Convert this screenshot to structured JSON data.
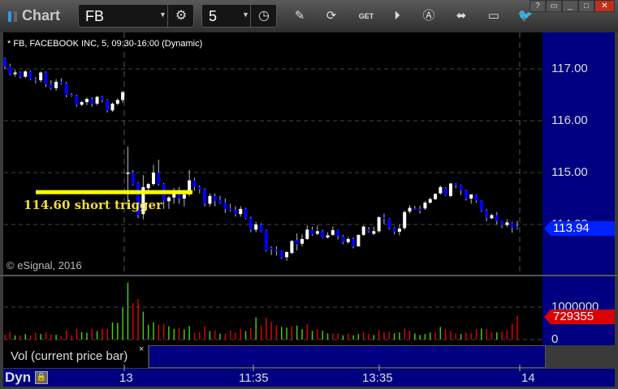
{
  "app": {
    "title": "Chart"
  },
  "toolbar": {
    "symbol": "FB",
    "interval": "5",
    "icons": [
      "settings-gear-icon",
      "clock-icon",
      "pencil-icon",
      "chart-refresh-icon",
      "get-icon",
      "play-icon",
      "alert-icon",
      "link-icon",
      "comment-icon",
      "twitter-icon"
    ],
    "get_label": "GET"
  },
  "window": {
    "help": "?",
    "minimize": "_",
    "maximize": "□",
    "close": "✕"
  },
  "chart": {
    "legend": "* FB, FACEBOOK INC, 5, 09:30-16:00 (Dynamic)",
    "copyright": "© eSignal, 2016",
    "annotation": {
      "label": "114.60 short trigger",
      "price": 114.6,
      "color": "#ffff00"
    },
    "price_ticks": [
      "117.00",
      "116.00",
      "115.00",
      "114.00"
    ],
    "price_tick_values": [
      117,
      116,
      115,
      114
    ],
    "last_price": "113.94",
    "colors": {
      "up": "#ffffff",
      "down": "#0000ff",
      "vol_up": "#44cc11",
      "vol_down": "#dd0000",
      "last_tag": "#0022ff",
      "vol_tag": "#dd0000"
    }
  },
  "chart_data": {
    "type": "candlestick",
    "session_break_index": 24,
    "ohlc": [
      [
        117.2,
        117.22,
        117.0,
        117.05
      ],
      [
        117.05,
        117.1,
        116.88,
        116.9
      ],
      [
        116.9,
        116.98,
        116.85,
        116.93
      ],
      [
        116.93,
        116.95,
        116.82,
        116.85
      ],
      [
        116.85,
        116.98,
        116.82,
        116.95
      ],
      [
        116.95,
        116.97,
        116.78,
        116.8
      ],
      [
        116.8,
        116.84,
        116.72,
        116.78
      ],
      [
        116.78,
        116.95,
        116.74,
        116.93
      ],
      [
        116.93,
        116.95,
        116.65,
        116.7
      ],
      [
        116.7,
        116.78,
        116.6,
        116.63
      ],
      [
        116.63,
        116.8,
        116.58,
        116.75
      ],
      [
        116.75,
        116.82,
        116.7,
        116.72
      ],
      [
        116.72,
        116.75,
        116.45,
        116.5
      ],
      [
        116.5,
        116.53,
        116.46,
        116.48
      ],
      [
        116.48,
        116.5,
        116.27,
        116.31
      ],
      [
        116.31,
        116.38,
        116.28,
        116.36
      ],
      [
        116.36,
        116.45,
        116.3,
        116.42
      ],
      [
        116.42,
        116.45,
        116.27,
        116.33
      ],
      [
        116.33,
        116.48,
        116.3,
        116.46
      ],
      [
        116.46,
        116.48,
        116.35,
        116.4
      ],
      [
        116.4,
        116.42,
        116.16,
        116.2
      ],
      [
        116.2,
        116.35,
        116.17,
        116.33
      ],
      [
        116.33,
        116.43,
        116.3,
        116.4
      ],
      [
        116.4,
        116.58,
        116.35,
        116.55
      ],
      [
        114.98,
        115.5,
        114.3,
        115.0
      ],
      [
        115.0,
        115.05,
        114.75,
        114.77
      ],
      [
        114.8,
        114.82,
        114.12,
        114.18
      ],
      [
        114.2,
        114.95,
        114.1,
        114.72
      ],
      [
        114.7,
        114.8,
        114.6,
        114.78
      ],
      [
        114.78,
        115.15,
        114.75,
        115.0
      ],
      [
        115.0,
        115.25,
        114.75,
        114.78
      ],
      [
        114.78,
        114.8,
        114.3,
        114.45
      ],
      [
        114.45,
        114.55,
        114.3,
        114.52
      ],
      [
        114.52,
        114.7,
        114.4,
        114.6
      ],
      [
        114.6,
        114.72,
        114.4,
        114.5
      ],
      [
        114.5,
        114.6,
        114.35,
        114.58
      ],
      [
        114.58,
        115.05,
        114.55,
        114.85
      ],
      [
        114.85,
        114.9,
        114.65,
        114.72
      ],
      [
        114.72,
        114.75,
        114.6,
        114.68
      ],
      [
        114.68,
        114.7,
        114.35,
        114.4
      ],
      [
        114.4,
        114.6,
        114.35,
        114.55
      ],
      [
        114.55,
        114.6,
        114.35,
        114.45
      ],
      [
        114.48,
        114.55,
        114.4,
        114.42
      ],
      [
        114.42,
        114.5,
        114.22,
        114.3
      ],
      [
        114.32,
        114.4,
        114.25,
        114.28
      ],
      [
        114.28,
        114.35,
        114.15,
        114.2
      ],
      [
        114.2,
        114.35,
        114.15,
        114.3
      ],
      [
        114.3,
        114.32,
        114.1,
        114.12
      ],
      [
        114.12,
        114.15,
        113.85,
        113.9
      ],
      [
        113.9,
        114.05,
        113.85,
        114.0
      ],
      [
        114.0,
        114.02,
        113.85,
        113.86
      ],
      [
        113.88,
        113.9,
        113.48,
        113.5
      ],
      [
        113.55,
        113.58,
        113.41,
        113.52
      ],
      [
        113.52,
        113.58,
        113.4,
        113.49
      ],
      [
        113.49,
        113.5,
        113.34,
        113.36
      ],
      [
        113.37,
        113.48,
        113.3,
        113.47
      ],
      [
        113.45,
        113.7,
        113.43,
        113.68
      ],
      [
        113.7,
        113.83,
        113.5,
        113.62
      ],
      [
        113.63,
        113.81,
        113.58,
        113.72
      ],
      [
        113.72,
        113.98,
        113.7,
        113.9
      ],
      [
        113.9,
        113.96,
        113.78,
        113.81
      ],
      [
        113.82,
        113.98,
        113.8,
        113.87
      ],
      [
        113.87,
        113.9,
        113.74,
        113.75
      ],
      [
        113.75,
        113.85,
        113.73,
        113.79
      ],
      [
        113.8,
        113.96,
        113.78,
        113.89
      ],
      [
        113.89,
        113.9,
        113.71,
        113.78
      ],
      [
        113.77,
        113.8,
        113.62,
        113.66
      ],
      [
        113.66,
        113.76,
        113.63,
        113.72
      ],
      [
        113.72,
        113.75,
        113.54,
        113.58
      ],
      [
        113.58,
        113.8,
        113.57,
        113.8
      ],
      [
        113.8,
        113.98,
        113.78,
        113.96
      ],
      [
        113.9,
        113.95,
        113.84,
        113.87
      ],
      [
        113.82,
        113.96,
        113.8,
        113.87
      ],
      [
        113.87,
        114.16,
        113.84,
        114.14
      ],
      [
        114.14,
        114.21,
        114.01,
        114.11
      ],
      [
        114.11,
        114.12,
        113.9,
        113.93
      ],
      [
        113.93,
        113.95,
        113.81,
        113.86
      ],
      [
        113.86,
        114.0,
        113.79,
        113.92
      ],
      [
        113.93,
        114.27,
        113.9,
        114.24
      ],
      [
        114.25,
        114.37,
        114.21,
        114.32
      ],
      [
        114.31,
        114.36,
        114.28,
        114.29
      ],
      [
        114.3,
        114.36,
        114.21,
        114.27
      ],
      [
        114.31,
        114.45,
        114.28,
        114.42
      ],
      [
        114.42,
        114.52,
        114.4,
        114.49
      ],
      [
        114.49,
        114.6,
        114.47,
        114.59
      ],
      [
        114.6,
        114.75,
        114.58,
        114.72
      ],
      [
        114.7,
        114.72,
        114.55,
        114.56
      ],
      [
        114.55,
        114.8,
        114.53,
        114.79
      ],
      [
        114.79,
        114.8,
        114.7,
        114.76
      ],
      [
        114.76,
        114.77,
        114.57,
        114.66
      ],
      [
        114.66,
        114.67,
        114.46,
        114.5
      ],
      [
        114.5,
        114.58,
        114.4,
        114.58
      ],
      [
        114.57,
        114.58,
        114.42,
        114.46
      ],
      [
        114.46,
        114.47,
        114.24,
        114.26
      ],
      [
        114.27,
        114.3,
        114.06,
        114.13
      ],
      [
        114.12,
        114.21,
        114.1,
        114.18
      ],
      [
        114.18,
        114.24,
        114.0,
        114.07
      ],
      [
        114.06,
        114.07,
        113.93,
        113.99
      ],
      [
        113.99,
        114.1,
        113.95,
        114.04
      ],
      [
        114.03,
        114.05,
        113.84,
        113.94
      ],
      [
        113.95,
        114.07,
        113.9,
        113.94
      ]
    ],
    "volume": [
      150000,
      250000,
      130000,
      130000,
      170000,
      130000,
      210000,
      170000,
      230000,
      170000,
      150000,
      100000,
      280000,
      130000,
      330000,
      230000,
      210000,
      330000,
      260000,
      330000,
      330000,
      530000,
      510000,
      980000,
      1760000,
      1130000,
      1250000,
      860000,
      460000,
      530000,
      460000,
      480000,
      410000,
      330000,
      360000,
      310000,
      410000,
      210000,
      230000,
      410000,
      260000,
      280000,
      180000,
      180000,
      280000,
      210000,
      330000,
      260000,
      360000,
      680000,
      430000,
      670000,
      540000,
      440000,
      390000,
      370000,
      420000,
      430000,
      320000,
      470000,
      270000,
      320000,
      270000,
      190000,
      190000,
      190000,
      130000,
      190000,
      130000,
      170000,
      220000,
      170000,
      140000,
      290000,
      220000,
      240000,
      190000,
      220000,
      340000,
      270000,
      190000,
      140000,
      170000,
      220000,
      220000,
      390000,
      320000,
      270000,
      190000,
      170000,
      220000,
      190000,
      320000,
      340000,
      320000,
      220000,
      220000,
      240000,
      290000,
      490000,
      729355
    ],
    "volume_direction": "rrgrgrrgrrgrrrrggrgrrgggg rrgggrrggrggrrrgrgrrrrgrg rrrrggrggrgrggrrgrggrrgrrr ggrrggggrgrrrgrrrgrrgrr",
    "volume_label": "Vol (current price bar)",
    "volume_ticks": [
      "1000000",
      "0"
    ],
    "volume_tick_values": [
      1000000,
      0
    ],
    "volume_last": "729355",
    "ylim": [
      113.0,
      117.6
    ],
    "x_ticks": [
      "13",
      "11:35",
      "13:35",
      "14"
    ]
  },
  "footer": {
    "mode": "Dyn"
  }
}
